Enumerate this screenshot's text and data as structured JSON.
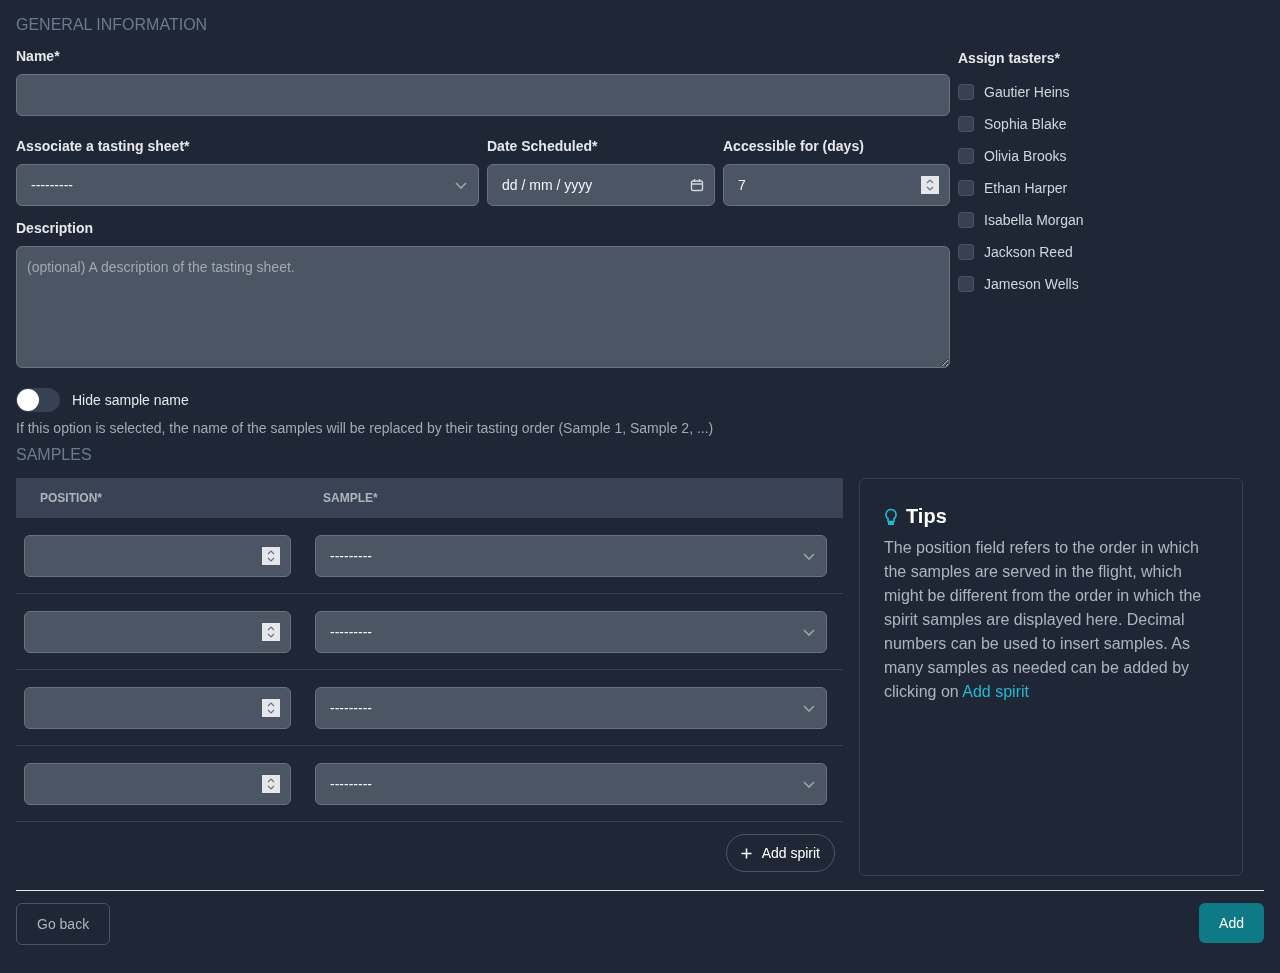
{
  "general": {
    "heading": "GENERAL INFORMATION",
    "name_field": {
      "label": "Name*"
    },
    "tasting_sheet": {
      "label": "Associate a tasting sheet*",
      "value": "---------"
    },
    "date": {
      "label": "Date Scheduled*",
      "placeholder": "dd / mm / yyyy"
    },
    "accessible": {
      "label": "Accessible for (days)",
      "value": "7"
    },
    "description": {
      "label": "Description",
      "placeholder": "(optional) A description of the tasting sheet."
    },
    "hide_sample_name": {
      "label": "Hide sample name",
      "on": false,
      "help": "If this option is selected, the name of the samples will be replaced by their tasting order (Sample 1, Sample 2, ...)"
    }
  },
  "tasters": {
    "label": "Assign tasters*",
    "items": [
      {
        "name": "Gautier Heins",
        "checked": false
      },
      {
        "name": "Sophia Blake",
        "checked": false
      },
      {
        "name": "Olivia Brooks",
        "checked": false
      },
      {
        "name": "Ethan Harper",
        "checked": false
      },
      {
        "name": "Isabella Morgan",
        "checked": false
      },
      {
        "name": "Jackson Reed",
        "checked": false
      },
      {
        "name": "Jameson Wells",
        "checked": false
      }
    ]
  },
  "samples": {
    "heading": "SAMPLES",
    "columns": [
      "POSITION*",
      "SAMPLE*"
    ],
    "rows": [
      {
        "sample": "---------"
      },
      {
        "sample": "---------"
      },
      {
        "sample": "---------"
      },
      {
        "sample": "---------"
      }
    ],
    "add_button": "Add spirit"
  },
  "tips": {
    "title": "Tips",
    "text": "The position field refers to the order in which the samples are served in the flight, which might be different from the order in which the spirit samples are displayed here. Decimal numbers can be used to insert samples. As many samples as needed can be added by clicking on",
    "link": "Add spirit"
  },
  "footer": {
    "back_button": "Go back",
    "submit_button": "Add"
  }
}
